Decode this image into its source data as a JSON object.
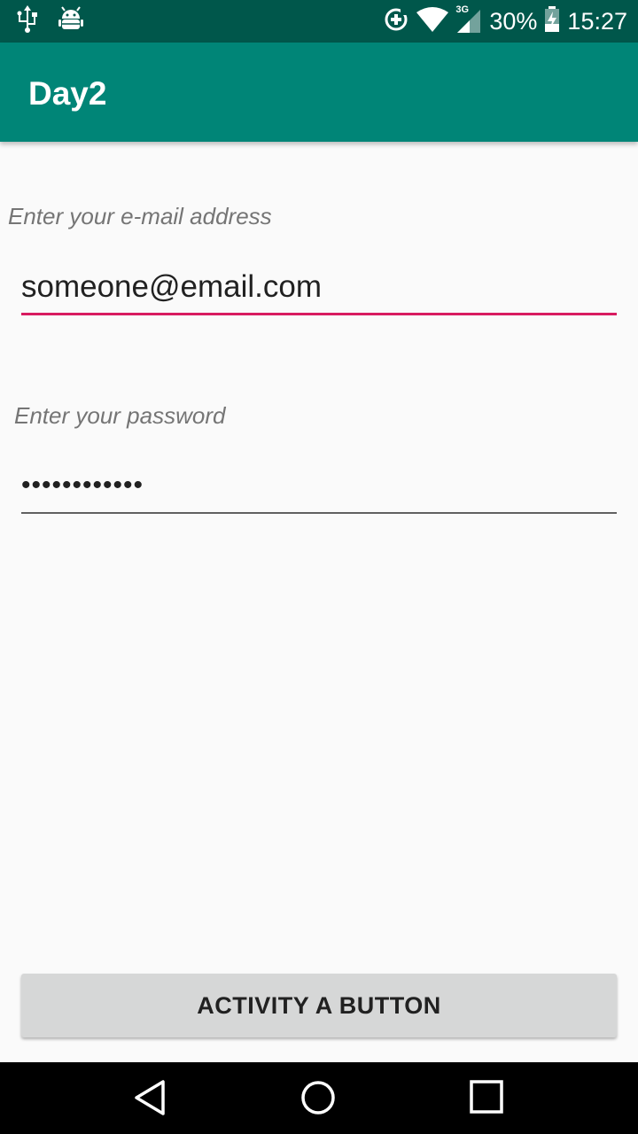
{
  "status_bar": {
    "left_icons": [
      "usb-icon",
      "android-debug-icon"
    ],
    "right_icons": [
      "data-saver-icon",
      "wifi-icon",
      "cellular-3g-icon",
      "battery-charging-icon"
    ],
    "network_type": "3G",
    "battery_percent": "30%",
    "time": "15:27",
    "color": "#00574b"
  },
  "app_bar": {
    "title": "Day2",
    "color": "#008577"
  },
  "form": {
    "email_label": "Enter your e-mail address",
    "email_value": "someone@email.com",
    "email_accent": "#d81b60",
    "password_label": "Enter your password",
    "password_value": "••••••••••••"
  },
  "button": {
    "label": "ACTIVITY A BUTTON"
  },
  "nav_bar": {
    "icons": [
      "back-icon",
      "home-icon",
      "recents-icon"
    ]
  }
}
